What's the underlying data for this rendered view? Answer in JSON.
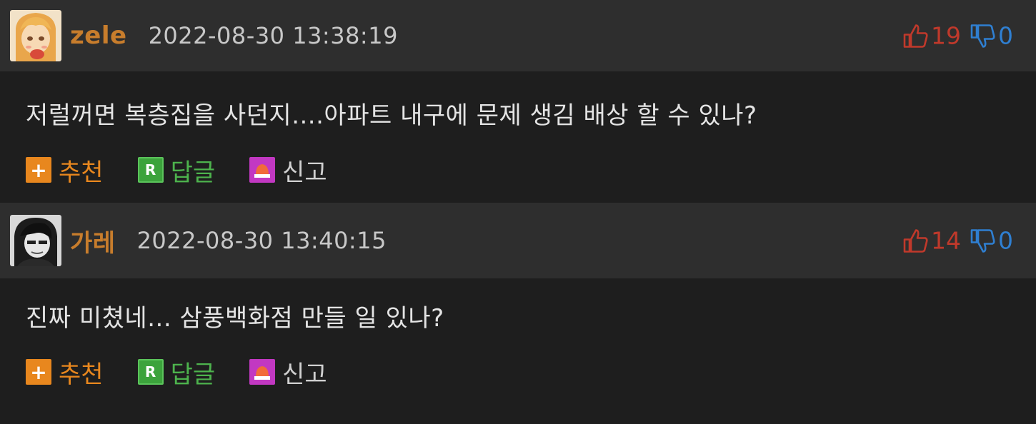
{
  "comments": [
    {
      "nickname": "zele",
      "timestamp": "2022-08-30 13:38:19",
      "upvotes": "19",
      "downvotes": "0",
      "text": "저럴꺼면 복층집을 사던지....아파트 내구에 문제 생김 배상 할 수 있나?",
      "actions": {
        "recommend": "추천",
        "reply": "답글",
        "report": "신고"
      },
      "recommend_icon_glyph": "+",
      "reply_icon_glyph": "R"
    },
    {
      "nickname": "가레",
      "timestamp": "2022-08-30 13:40:15",
      "upvotes": "14",
      "downvotes": "0",
      "text": "진짜 미쳤네... 삼풍백화점 만들 일 있나?",
      "actions": {
        "recommend": "추천",
        "reply": "답글",
        "report": "신고"
      },
      "recommend_icon_glyph": "+",
      "reply_icon_glyph": "R"
    }
  ],
  "icons": {
    "avatar_1": "avatar-blonde-character",
    "avatar_2": "avatar-grayscale-person",
    "upvote": "thumbs-up-outline-icon",
    "downvote": "thumbs-down-outline-icon",
    "recommend": "plus-square-icon",
    "reply": "r-square-icon",
    "report": "siren-icon"
  },
  "colors": {
    "header_bg": "#2e2e2e",
    "body_bg": "#1e1e1e",
    "nickname": "#c87d2c",
    "timestamp": "#c8c8c8",
    "text": "#e4e4e4",
    "upvote": "#c0392b",
    "downvote": "#2f7fd1",
    "recommend": "#e8871e",
    "reply": "#3ca33c",
    "report": "#c238c2"
  }
}
